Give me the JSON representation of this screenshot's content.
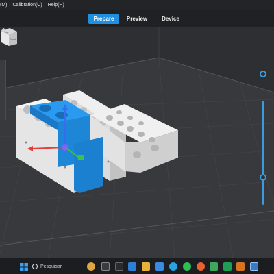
{
  "menubar": {
    "items": [
      {
        "label": "(M)"
      },
      {
        "label": "Calibration(C)"
      },
      {
        "label": "Help(H)"
      }
    ]
  },
  "tabs": [
    {
      "label": "Prepare",
      "active": true
    },
    {
      "label": "Preview",
      "active": false
    },
    {
      "label": "Device",
      "active": false
    }
  ],
  "viewcube": {
    "top_label": "Top",
    "front_label": "Front"
  },
  "taskbar": {
    "search_label": "Pesquisar",
    "icons": [
      "windows-start-icon",
      "search-icon",
      "widget-icon",
      "task-view-icon",
      "vscode-icon",
      "file-explorer-icon",
      "store-icon",
      "telegram-icon",
      "whatsapp-icon",
      "firefox-icon",
      "excel-icon",
      "app-icon",
      "slicer-app-icon"
    ]
  },
  "colors": {
    "accent": "#1f8fe0",
    "slider": "#3a9be0",
    "selected_part": "#1e90e0"
  }
}
